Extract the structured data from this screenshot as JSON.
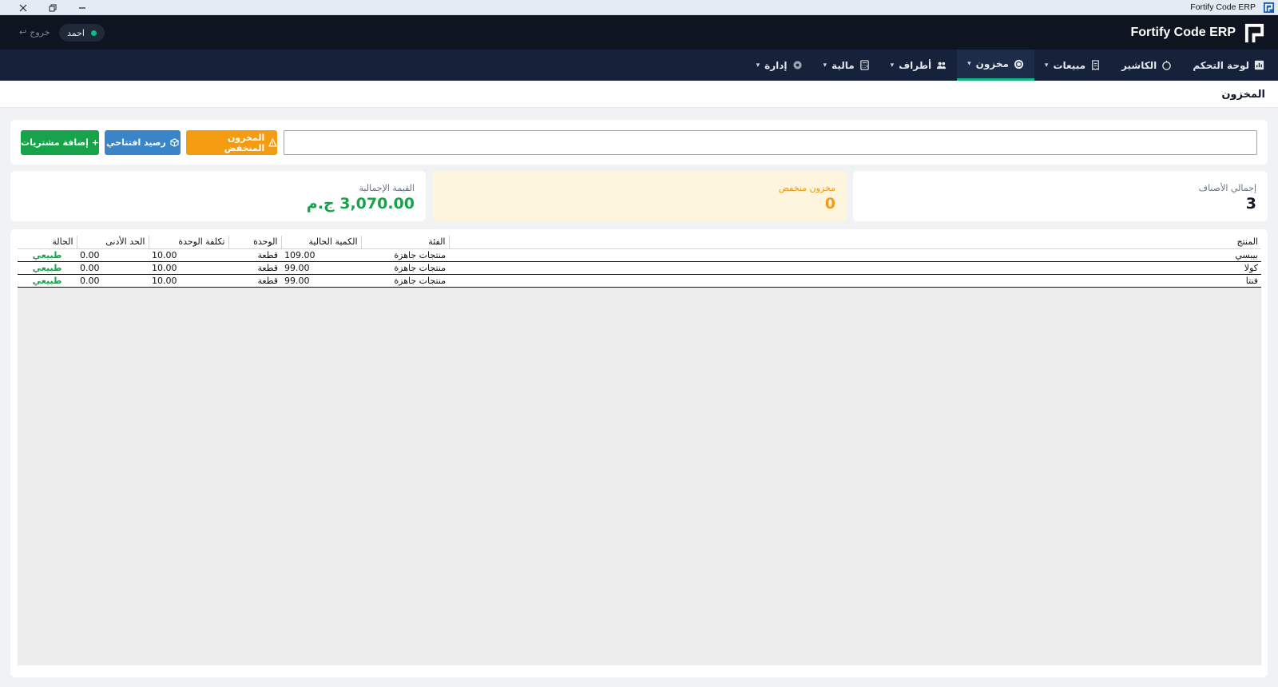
{
  "window": {
    "title": "Fortify Code ERP",
    "controls": [
      "close-icon",
      "restore-icon",
      "minimize-icon"
    ]
  },
  "header": {
    "brand": "Fortify Code ERP",
    "user": "احمد",
    "logout": "خروج"
  },
  "nav": [
    {
      "label": "لوحة التحكم",
      "icon": "dashboard-icon",
      "dropdown": false,
      "active": false
    },
    {
      "label": "الكاشير",
      "icon": "cashier-icon",
      "dropdown": false,
      "active": false
    },
    {
      "label": "مبيعات",
      "icon": "receipt-icon",
      "dropdown": true,
      "active": false
    },
    {
      "label": "مخزون",
      "icon": "box-icon",
      "dropdown": true,
      "active": true
    },
    {
      "label": "أطراف",
      "icon": "people-icon",
      "dropdown": true,
      "active": false
    },
    {
      "label": "مالية",
      "icon": "calculator-icon",
      "dropdown": true,
      "active": false
    },
    {
      "label": "إدارة",
      "icon": "gear-icon",
      "dropdown": true,
      "active": false
    }
  ],
  "page": {
    "title": "المخزون"
  },
  "toolbar": {
    "search_placeholder": "",
    "low_stock_label": "المخزون المنخفض",
    "opening_balance_label": "رصيد افتتاحي",
    "add_purchases_label": "+ إضافة مشتريات"
  },
  "stats": {
    "total_items_label": "إجمالي الأصناف",
    "total_items_value": "3",
    "low_stock_label": "مخزون منخفض",
    "low_stock_value": "0",
    "total_value_label": "القيمة الإجمالية",
    "total_value_value": "3,070.00 ج.م"
  },
  "table": {
    "columns": [
      "المنتج",
      "الفئة",
      "الكمية الحالية",
      "الوحدة",
      "تكلفة الوحدة",
      "الحد الأدنى",
      "الحالة"
    ],
    "rows": [
      {
        "product": "بيبسي",
        "category": "منتجات جاهزة",
        "qty": "109.00",
        "unit": "قطعة",
        "cost": "10.00",
        "min": "0.00",
        "status": "طبيعي"
      },
      {
        "product": "كولا",
        "category": "منتجات جاهزة",
        "qty": "99.00",
        "unit": "قطعة",
        "cost": "10.00",
        "min": "0.00",
        "status": "طبيعي"
      },
      {
        "product": "فنتا",
        "category": "منتجات جاهزة",
        "qty": "99.00",
        "unit": "قطعة",
        "cost": "10.00",
        "min": "0.00",
        "status": "طبيعي"
      }
    ]
  },
  "colors": {
    "header_bg": "#0f1520",
    "nav_bg": "#16213a",
    "accent_green": "#16a34a",
    "accent_blue": "#3a85c7",
    "accent_orange": "#f39c12",
    "active_indicator": "#10b981"
  }
}
